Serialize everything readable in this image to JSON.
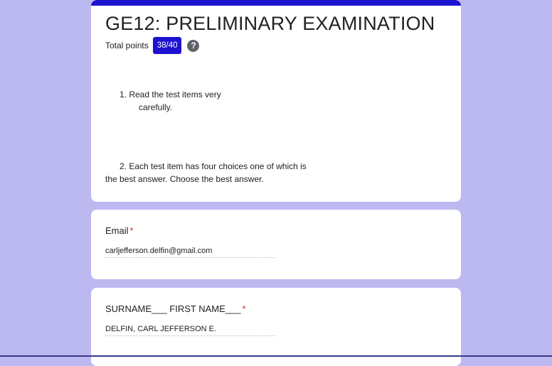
{
  "form": {
    "title": "GE12: PRELIMINARY EXAMINATION",
    "total_points_label": "Total points",
    "score": "38/40",
    "help_icon": "help-icon",
    "instructions": {
      "item1_line1": "1. Read the test items very",
      "item1_line2": "carefully.",
      "item2_line1": "2. Each test item has four choices one of which is",
      "item2_line2": "the best answer. Choose the best answer."
    }
  },
  "questions": [
    {
      "title": "Email",
      "required_mark": "*",
      "answer": "carljefferson.delfin@gmail.com"
    },
    {
      "title": "SURNAME___ FIRST NAME___",
      "required_mark": "*",
      "answer": "DELFIN, CARL JEFFERSON E."
    }
  ],
  "colors": {
    "accent": "#1d12d0",
    "background": "#bcb8f0",
    "required": "#d93025"
  }
}
